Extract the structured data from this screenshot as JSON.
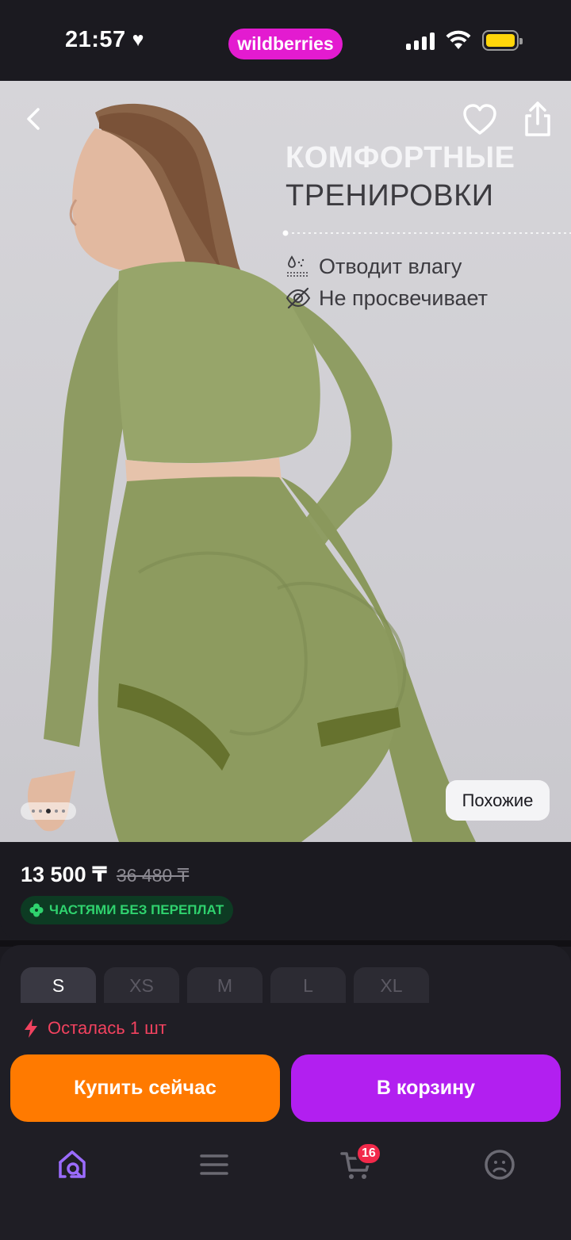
{
  "status_bar": {
    "time": "21:57",
    "brand": "wildberries",
    "colors": {
      "brand_bg": "#e31bd0",
      "battery": "#ffd60a"
    }
  },
  "hero": {
    "promo_title_line1": "КОМФОРТНЫЕ",
    "promo_title_line2": "ТРЕНИРОВКИ",
    "features": [
      {
        "icon": "moisture-icon",
        "text": "Отводит влагу"
      },
      {
        "icon": "eye-off-icon",
        "text": "Не просвечивает"
      }
    ],
    "similar_button": "Похожие",
    "pager": {
      "count": 5,
      "active": 3
    }
  },
  "price": {
    "current": "13 500 ₸",
    "old": "36 480 ₸",
    "installment": "ЧАСТЯМИ БЕЗ ПЕРЕПЛАТ"
  },
  "sizes": {
    "options": [
      "S",
      "XS",
      "M",
      "L",
      "XL"
    ],
    "selected": "S"
  },
  "stock_warning": "Осталась 1 шт",
  "actions": {
    "buy_now": "Купить сейчас",
    "add_to_cart": "В корзину",
    "colors": {
      "buy_now": "#ff7a00",
      "add_to_cart": "#b21ff0"
    }
  },
  "tabbar": {
    "items": [
      {
        "icon": "home-search-icon",
        "active": true
      },
      {
        "icon": "menu-icon",
        "active": false
      },
      {
        "icon": "cart-icon",
        "active": false,
        "badge": "16"
      },
      {
        "icon": "profile-icon",
        "active": false
      }
    ]
  }
}
